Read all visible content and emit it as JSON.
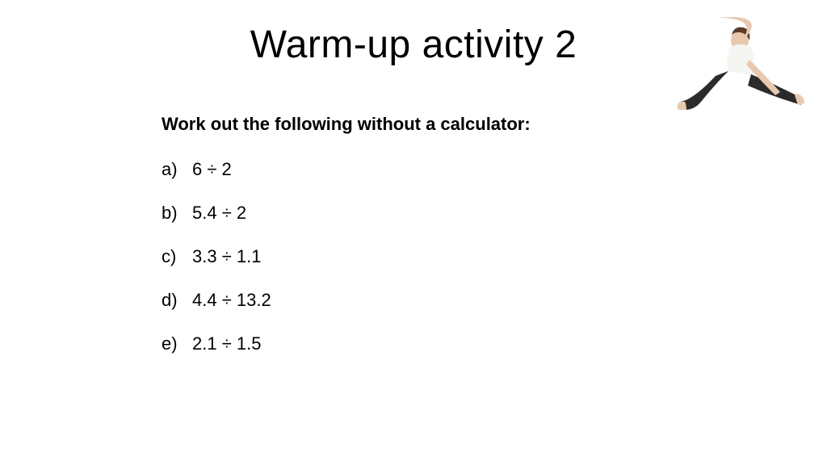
{
  "title": "Warm-up activity 2",
  "instruction": "Work out the following without a calculator:",
  "problems": [
    {
      "label": "a)",
      "expression": "6 ÷ 2"
    },
    {
      "label": "b)",
      "expression": "5.4 ÷ 2"
    },
    {
      "label": "c)",
      "expression": "3.3 ÷ 1.1"
    },
    {
      "label": "d)",
      "expression": "4.4 ÷ 13.2"
    },
    {
      "label": "e)",
      "expression": "2.1 ÷ 1.5"
    }
  ],
  "illustration_desc": "person-stretching"
}
